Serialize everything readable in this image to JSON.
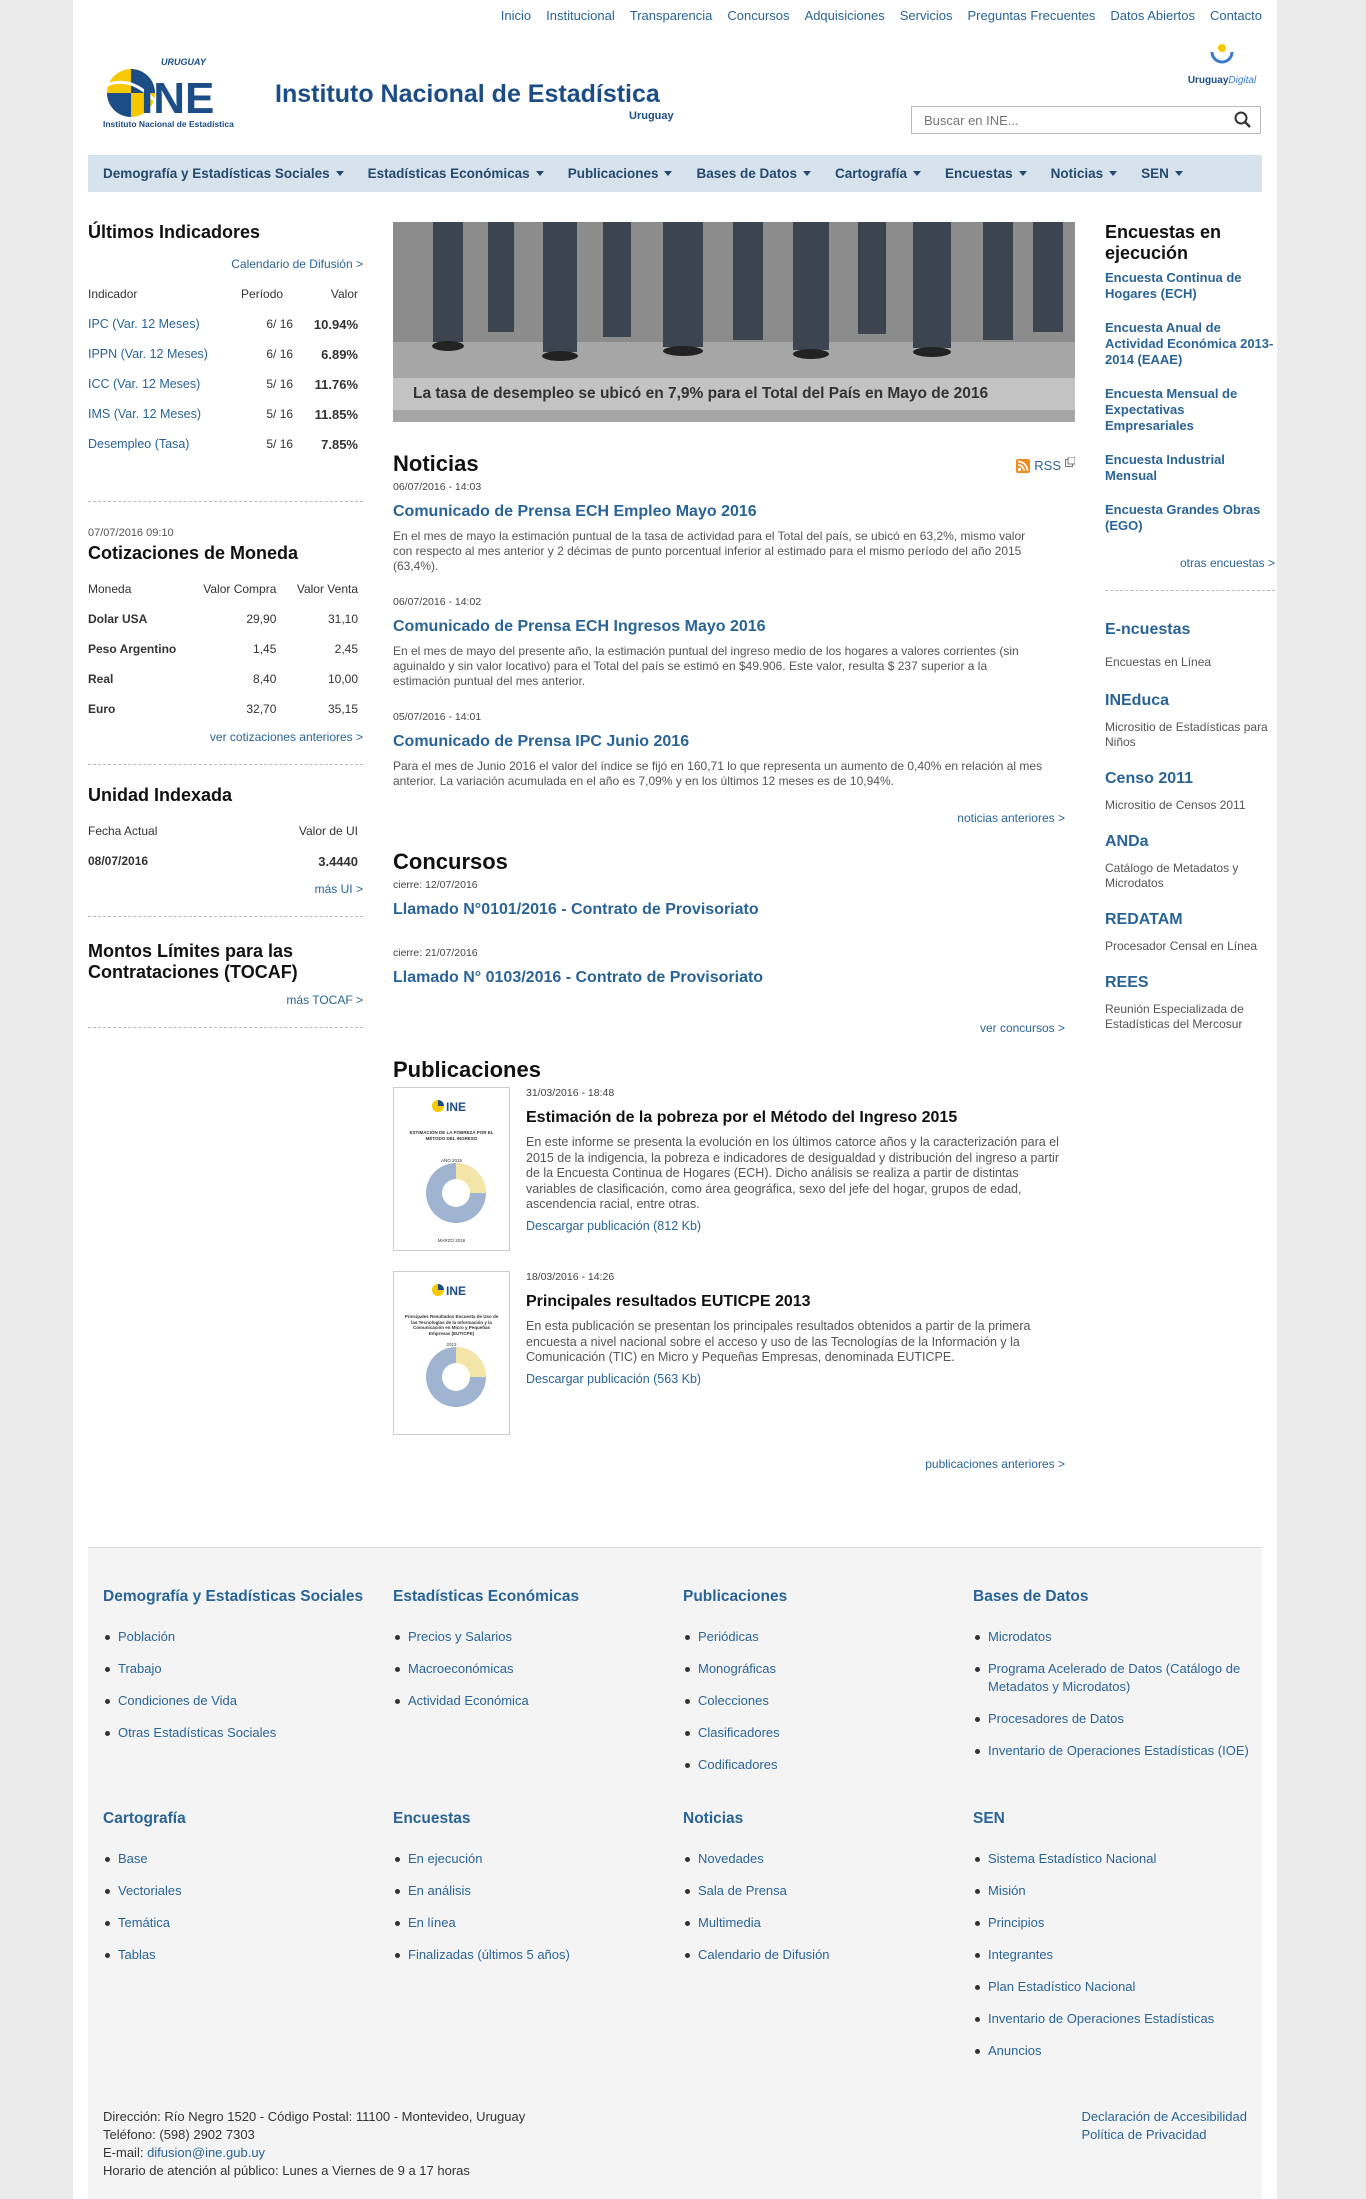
{
  "topnav": [
    "Inicio",
    "Institucional",
    "Transparencia",
    "Concursos",
    "Adquisiciones",
    "Servicios",
    "Preguntas Frecuentes",
    "Datos Abiertos",
    "Contacto"
  ],
  "brand": {
    "title": "Instituto Nacional de Estadística",
    "subtitle": "Uruguay",
    "logo_top": "URUGUAY",
    "logo_main": "INE",
    "logo_caption": "Instituto Nacional de Estadística",
    "digital_a": "Uruguay",
    "digital_b": "Digital"
  },
  "search": {
    "placeholder": "Buscar en INE..."
  },
  "menu": [
    "Demografía y Estadísticas Sociales",
    "Estadísticas Económicas",
    "Publicaciones",
    "Bases de Datos",
    "Cartografía",
    "Encuestas",
    "Noticias",
    "SEN"
  ],
  "indicadores": {
    "title": "Últimos Indicadores",
    "calendar_link": "Calendario de Difusión >",
    "headers": [
      "Indicador",
      "Período",
      "Valor"
    ],
    "rows": [
      {
        "name": "IPC (Var. 12 Meses)",
        "period": "6/ 16",
        "value": "10.94%"
      },
      {
        "name": "IPPN (Var. 12 Meses)",
        "period": "6/ 16",
        "value": "6.89%"
      },
      {
        "name": "ICC (Var. 12 Meses)",
        "period": "5/ 16",
        "value": "11.76%"
      },
      {
        "name": "IMS (Var. 12 Meses)",
        "period": "5/ 16",
        "value": "11.85%"
      },
      {
        "name": "Desempleo (Tasa)",
        "period": "5/ 16",
        "value": "7.85%"
      }
    ]
  },
  "moneda": {
    "date": "07/07/2016 09:10",
    "title": "Cotizaciones de Moneda",
    "headers": [
      "Moneda",
      "Valor Compra",
      "Valor Venta"
    ],
    "rows": [
      {
        "name": "Dolar USA",
        "buy": "29,90",
        "sell": "31,10"
      },
      {
        "name": "Peso Argentino",
        "buy": "1,45",
        "sell": "2,45"
      },
      {
        "name": "Real",
        "buy": "8,40",
        "sell": "10,00"
      },
      {
        "name": "Euro",
        "buy": "32,70",
        "sell": "35,15"
      }
    ],
    "link": "ver cotizaciones anteriores >"
  },
  "ui": {
    "title": "Unidad Indexada",
    "h1": "Fecha Actual",
    "h2": "Valor de UI",
    "date": "08/07/2016",
    "value": "3.4440",
    "link": "más UI >"
  },
  "tocaf": {
    "title": "Montos Límites para las Contrataciones (TOCAF)",
    "link": "más TOCAF >"
  },
  "banner": {
    "caption": "La tasa de desempleo se ubicó en 7,9% para el Total del País en Mayo de 2016"
  },
  "noticias": {
    "title": "Noticias",
    "rss": "RSS",
    "items": [
      {
        "date": "06/07/2016 - 14:03",
        "title": "Comunicado de Prensa ECH Empleo Mayo 2016",
        "body": "En el mes de mayo la estimación puntual de la tasa de actividad para el Total del país, se ubicó en 63,2%, mismo valor con respecto al mes anterior y 2 décimas de punto porcentual inferior al estimado para el mismo período del año 2015 (63,4%)."
      },
      {
        "date": "06/07/2016 - 14:02",
        "title": "Comunicado de Prensa ECH Ingresos Mayo 2016",
        "body": "En el mes de mayo del presente año, la estimación puntual del ingreso medio de los hogares a valores corrientes (sin aguinaldo y sin valor locativo) para el Total del país se estimó en $49.906. Este valor, resulta $ 237 superior a la estimación puntual del mes anterior."
      },
      {
        "date": "05/07/2016 - 14:01",
        "title": "Comunicado de Prensa IPC Junio 2016",
        "body": "Para el mes de Junio 2016 el valor del índice se fijó en 160,71 lo que representa un aumento de 0,40% en relación al mes anterior. La variación acumulada en el año es 7,09% y en los últimos 12 meses es de 10,94%."
      }
    ],
    "more": "noticias anteriores >"
  },
  "concursos": {
    "title": "Concursos",
    "items": [
      {
        "date": "cierre: 12/07/2016",
        "title": "Llamado N°0101/2016 - Contrato de Provisoriato"
      },
      {
        "date": "cierre: 21/07/2016",
        "title": "Llamado N° 0103/2016 - Contrato de Provisoriato"
      }
    ],
    "more": "ver concursos >"
  },
  "publicaciones": {
    "title": "Publicaciones",
    "items": [
      {
        "date": "31/03/2016 - 18:48",
        "title": "Estimación de la pobreza por el Método del Ingreso 2015",
        "body": "En este informe se presenta la evolución en los últimos catorce años y la caracterización para el 2015 de la indigencia, la pobreza e indicadores de desigualdad y distribución del ingreso a partir de la Encuesta Continua de Hogares (ECH). Dicho análisis se realiza a partir de distintas variables de clasificación, como área geográfica, sexo del jefe del hogar, grupos de edad, ascendencia racial, entre otras.",
        "download": "Descargar publicación (812 Kb)",
        "thumb_text": "ESTIMACIÓN DE LA POBREZA POR EL MÉTODO DEL INGRESO",
        "thumb_year": "AÑO 2015",
        "thumb_date": "MARZO 2016"
      },
      {
        "date": "18/03/2016 - 14:26",
        "title": "Principales resultados EUTICPE 2013",
        "body": "En esta publicación se presentan los principales resultados obtenidos a partir de la primera encuesta a nivel nacional sobre el acceso y uso de las Tecnologías de la Información y la Comunicación (TIC) en Micro y Pequeñas Empresas, denominada EUTICPE.",
        "download": "Descargar publicación (563 Kb)",
        "thumb_text": "Principales Resultados Encuesta de Uso de las Tecnologías de la Información y la Comunicación en Micro y Pequeñas Empresas (EUTICPE)",
        "thumb_year": "2013",
        "thumb_date": ""
      }
    ],
    "more": "publicaciones anteriores >"
  },
  "encuestas": {
    "title": "Encuestas en ejecución",
    "items": [
      "Encuesta Continua de Hogares (ECH)",
      "Encuesta Anual de Actividad Económica 2013-2014 (EAAE)",
      "Encuesta Mensual de Expectativas Empresariales",
      "Encuesta Industrial Mensual",
      "Encuesta Grandes Obras (EGO)"
    ],
    "more": "otras encuestas >"
  },
  "sites": [
    {
      "title": "E-ncuestas",
      "desc": "Encuestas en Línea"
    },
    {
      "title": "INEduca",
      "desc": "Micrositio de Estadísticas para Niños"
    },
    {
      "title": "Censo 2011",
      "desc": "Micrositio de Censos 2011"
    },
    {
      "title": "ANDa",
      "desc": "Catálogo de Metadatos y Microdatos"
    },
    {
      "title": "REDATAM",
      "desc": "Procesador Censal en Línea"
    },
    {
      "title": "REES",
      "desc": "Reunión Especializada de Estadísticas del Mercosur"
    }
  ],
  "footer": {
    "cols": [
      {
        "title": "Demografía y Estadísticas Sociales",
        "items": [
          "Población",
          "Trabajo",
          "Condiciones de Vida",
          "Otras Estadísticas Sociales"
        ]
      },
      {
        "title": "Estadísticas Económicas",
        "items": [
          "Precios y Salarios",
          "Macroeconómicas",
          "Actividad Económica"
        ]
      },
      {
        "title": "Publicaciones",
        "items": [
          "Periódicas",
          "Monográficas",
          "Colecciones",
          "Clasificadores",
          "Codificadores"
        ]
      },
      {
        "title": "Bases de Datos",
        "items": [
          "Microdatos",
          "Programa Acelerado de Datos (Catálogo de Metadatos y Microdatos)",
          "Procesadores de Datos",
          "Inventario de Operaciones Estadísticas (IOE)"
        ]
      },
      {
        "title": "Cartografía",
        "items": [
          "Base",
          "Vectoriales",
          "Temática",
          "Tablas"
        ]
      },
      {
        "title": "Encuestas",
        "items": [
          "En ejecución",
          "En análisis",
          "En línea",
          "Finalizadas (últimos 5 años)"
        ]
      },
      {
        "title": "Noticias",
        "items": [
          "Novedades",
          "Sala de Prensa",
          "Multimedia",
          "Calendario de Difusión"
        ]
      },
      {
        "title": "SEN",
        "items": [
          "Sistema Estadístico Nacional",
          "Misión",
          "Principios",
          "Integrantes",
          "Plan Estadístico Nacional",
          "Inventario de Operaciones Estadísticas",
          "Anuncios"
        ]
      }
    ],
    "address": "Dirección: Río Negro 1520 - Código Postal: 11100 - Montevideo, Uruguay",
    "phone": "Teléfono: (598) 2902 7303",
    "email_label": "E-mail: ",
    "email": "difusion@ine.gub.uy",
    "hours": "Horario de atención al público: Lunes a Viernes de 9 a 17 horas",
    "links": [
      "Declaración de Accesibilidad",
      "Política de Privacidad"
    ]
  },
  "colors": {
    "brand": "#1c4d86",
    "link": "#2a6496",
    "menu_bg": "#d6e3ec",
    "accent_yellow": "#f7c800"
  }
}
